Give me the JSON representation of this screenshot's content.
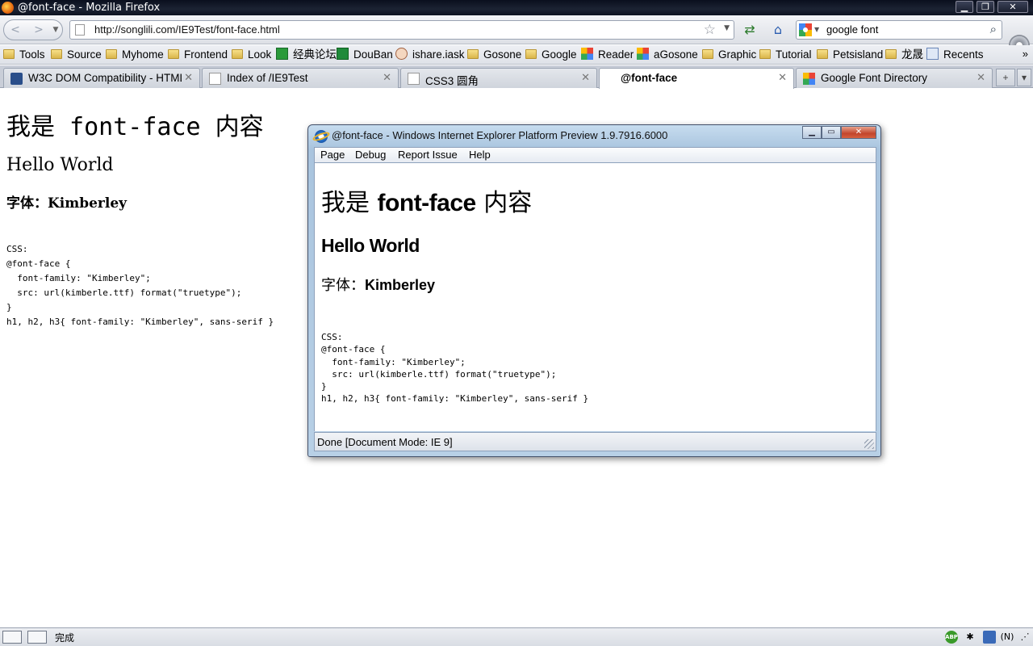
{
  "window": {
    "title": "@font-face - Mozilla Firefox"
  },
  "navbar": {
    "url": "http://songlili.com/IE9Test/font-face.html",
    "search_value": "google font"
  },
  "bookmarks": {
    "items": [
      {
        "label": "Tools",
        "icon": "folder-icon"
      },
      {
        "label": "Source",
        "icon": "folder-icon"
      },
      {
        "label": "Myhome",
        "icon": "folder-icon"
      },
      {
        "label": "Frontend",
        "icon": "folder-icon"
      },
      {
        "label": "Look",
        "icon": "folder-icon"
      },
      {
        "label": "经典论坛",
        "icon": "forum-icon"
      },
      {
        "label": "DouBan",
        "icon": "douban-icon"
      },
      {
        "label": "ishare.iask",
        "icon": "ishare-icon"
      },
      {
        "label": "Gosone",
        "icon": "folder-icon"
      },
      {
        "label": "Google",
        "icon": "folder-icon"
      },
      {
        "label": "Reader",
        "icon": "google-icon"
      },
      {
        "label": "aGosone",
        "icon": "google-icon"
      },
      {
        "label": "Graphic",
        "icon": "folder-icon"
      },
      {
        "label": "Tutorial",
        "icon": "folder-icon"
      },
      {
        "label": "Petsisland",
        "icon": "folder-icon"
      },
      {
        "label": "龙晟",
        "icon": "folder-icon"
      },
      {
        "label": "Recents",
        "icon": "recents-icon"
      }
    ],
    "more": "»"
  },
  "tabs": [
    {
      "label": "W3C DOM Compatibility - HTML",
      "active": false
    },
    {
      "label": "Index of /IE9Test",
      "active": false
    },
    {
      "label": "CSS3 圆角",
      "active": false
    },
    {
      "label": "@font-face",
      "active": true
    },
    {
      "label": "Google Font Directory",
      "active": false
    }
  ],
  "page": {
    "h1": "我是 font-face 内容",
    "h2": "Hello World",
    "h3": "字体：Kimberley",
    "code_lines": [
      "CSS:",
      "@font-face {",
      "  font-family: \"Kimberley\";",
      "  src: url(kimberle.ttf) format(\"truetype\");",
      "}",
      "h1, h2, h3{ font-family: \"Kimberley\", sans-serif }"
    ]
  },
  "ie_window": {
    "title": "@font-face - Windows Internet Explorer Platform Preview 1.9.7916.6000",
    "menu": [
      "Page",
      "Debug",
      "Report Issue",
      "Help"
    ],
    "h1_prefix": "我是 ",
    "h1_font": "font-face",
    "h1_suffix": " 内容",
    "h2": "Hello World",
    "h3_prefix": "字体：",
    "h3_font": "Kimberley",
    "status": "Done [Document Mode: IE 9]"
  },
  "statusbar": {
    "text": "完成",
    "lang_indicator": "(N)",
    "abp": "ABP"
  },
  "colors": {
    "titlebar": "#0d1220",
    "ie_frame": "#b8d0e6",
    "ie_close": "#c2452c"
  }
}
